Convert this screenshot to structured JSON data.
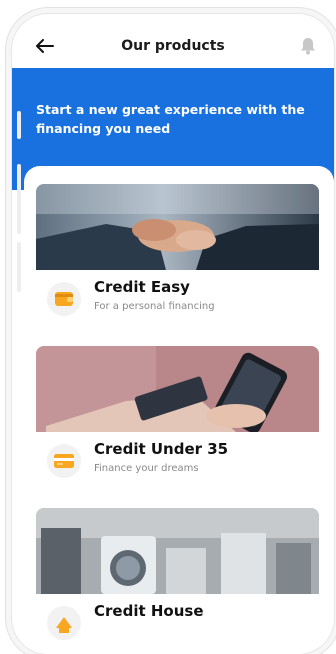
{
  "header": {
    "title": "Our products"
  },
  "hero": {
    "text": "Start a new great experience with the financing you need"
  },
  "products": [
    {
      "title": "Credit Easy",
      "subtitle": "For a personal financing",
      "icon": "wallet-icon"
    },
    {
      "title": "Credit Under 35",
      "subtitle": "Finance your dreams",
      "icon": "credit-card-icon"
    },
    {
      "title": "Credit House",
      "subtitle": "",
      "icon": "house-icon"
    }
  ],
  "colors": {
    "primary": "#1971e0",
    "accent": "#f9a620"
  }
}
